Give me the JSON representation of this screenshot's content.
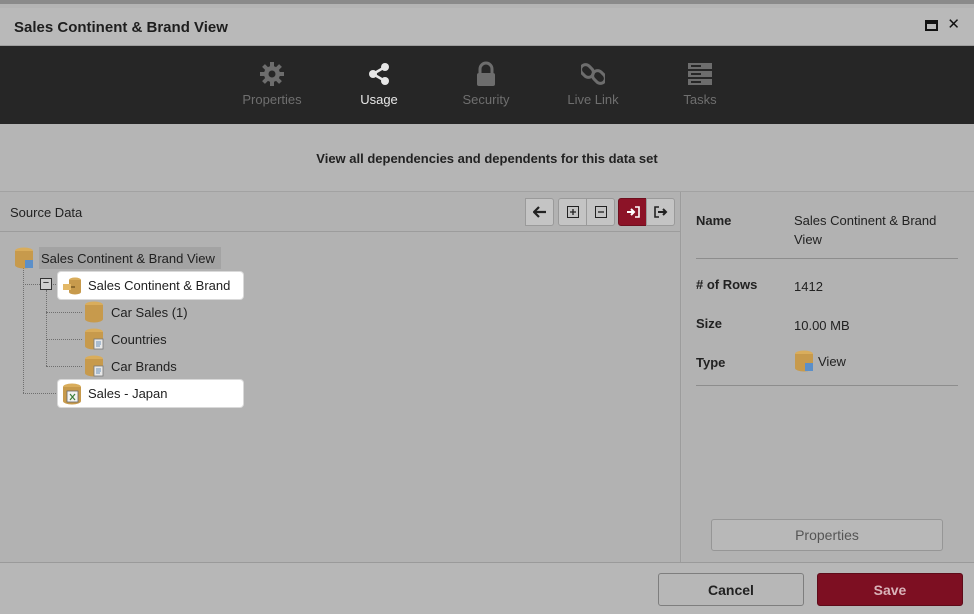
{
  "window": {
    "title": "Sales Continent & Brand View"
  },
  "tabs": [
    {
      "label": "Properties",
      "icon": "gear-icon"
    },
    {
      "label": "Usage",
      "icon": "share-icon",
      "active": true
    },
    {
      "label": "Security",
      "icon": "lock-icon"
    },
    {
      "label": "Live Link",
      "icon": "link-icon"
    },
    {
      "label": "Tasks",
      "icon": "server-icon"
    }
  ],
  "subtitle": "View all dependencies and dependents for this data set",
  "source_pane": {
    "title": "Source Data"
  },
  "tree": {
    "root": "Sales Continent & Brand View",
    "blend": "Sales Continent & Brand",
    "children": [
      "Car Sales (1)",
      "Countries",
      "Car Brands"
    ],
    "sibling": "Sales - Japan"
  },
  "details": {
    "name_key": "Name",
    "name_val": "Sales Continent & Brand View",
    "rows_key": "# of Rows",
    "rows_val": "1412",
    "size_key": "Size",
    "size_val": "10.00 MB",
    "type_key": "Type",
    "type_val": "View",
    "properties_button": "Properties"
  },
  "footer": {
    "cancel": "Cancel",
    "save": "Save"
  },
  "colors": {
    "accent": "#8c1327",
    "tab_bg": "#262626",
    "db_gold": "#c79a4c"
  }
}
